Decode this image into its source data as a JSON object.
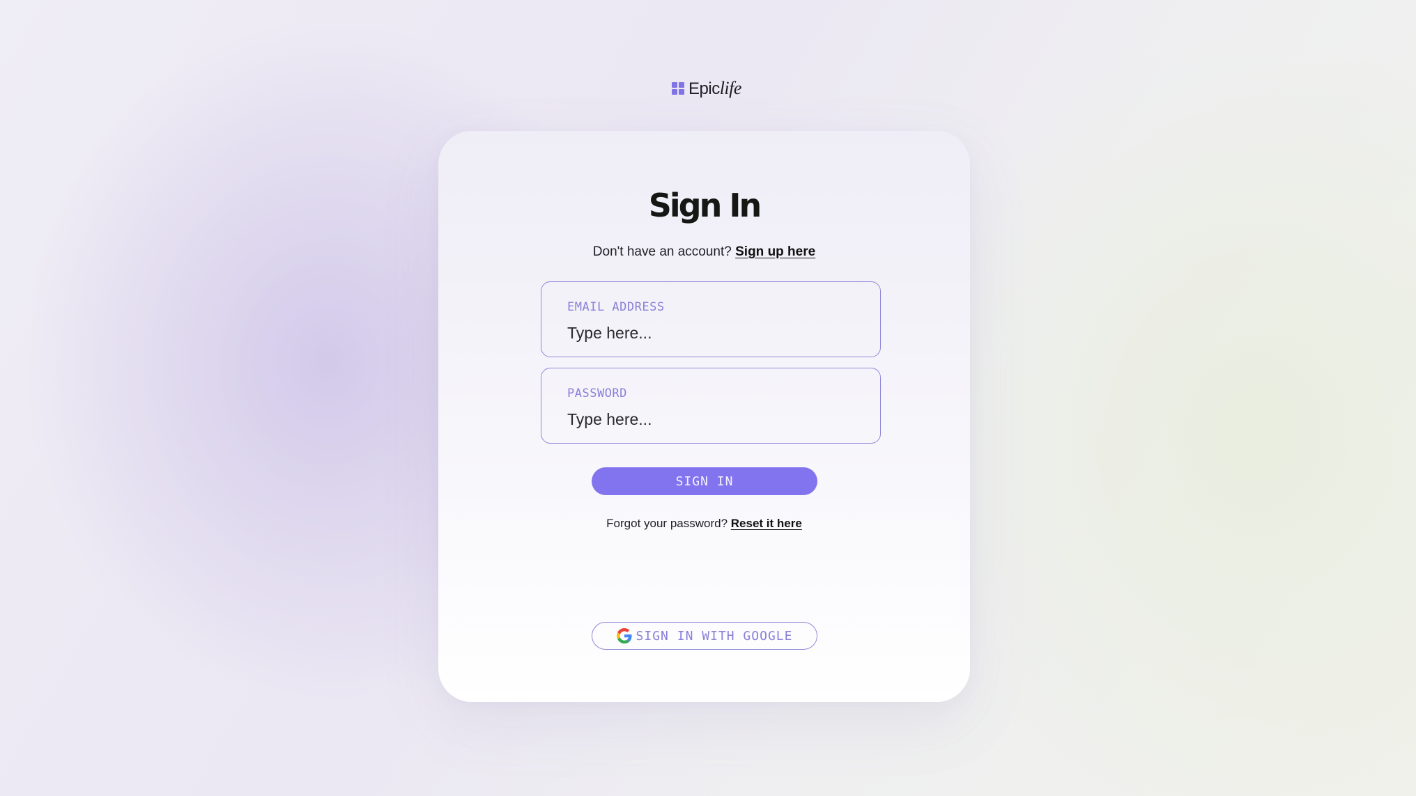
{
  "brand": {
    "name_regular": "Epic",
    "name_italic": "life",
    "logo_icon": "grid-squares-icon",
    "accent_color": "#8274ee"
  },
  "signin": {
    "title": "Sign In",
    "signup_prompt": "Don't have an account?",
    "signup_link": "Sign up here",
    "email": {
      "label": "EMAIL ADDRESS",
      "placeholder": "Type here...",
      "value": ""
    },
    "password": {
      "label": "PASSWORD",
      "placeholder": "Type here...",
      "value": ""
    },
    "submit_label": "SIGN IN",
    "forgot_prompt": "Forgot your password?",
    "reset_link": "Reset it here",
    "google_label": "SIGN IN WITH GOOGLE",
    "google_icon": "google-g-icon"
  }
}
